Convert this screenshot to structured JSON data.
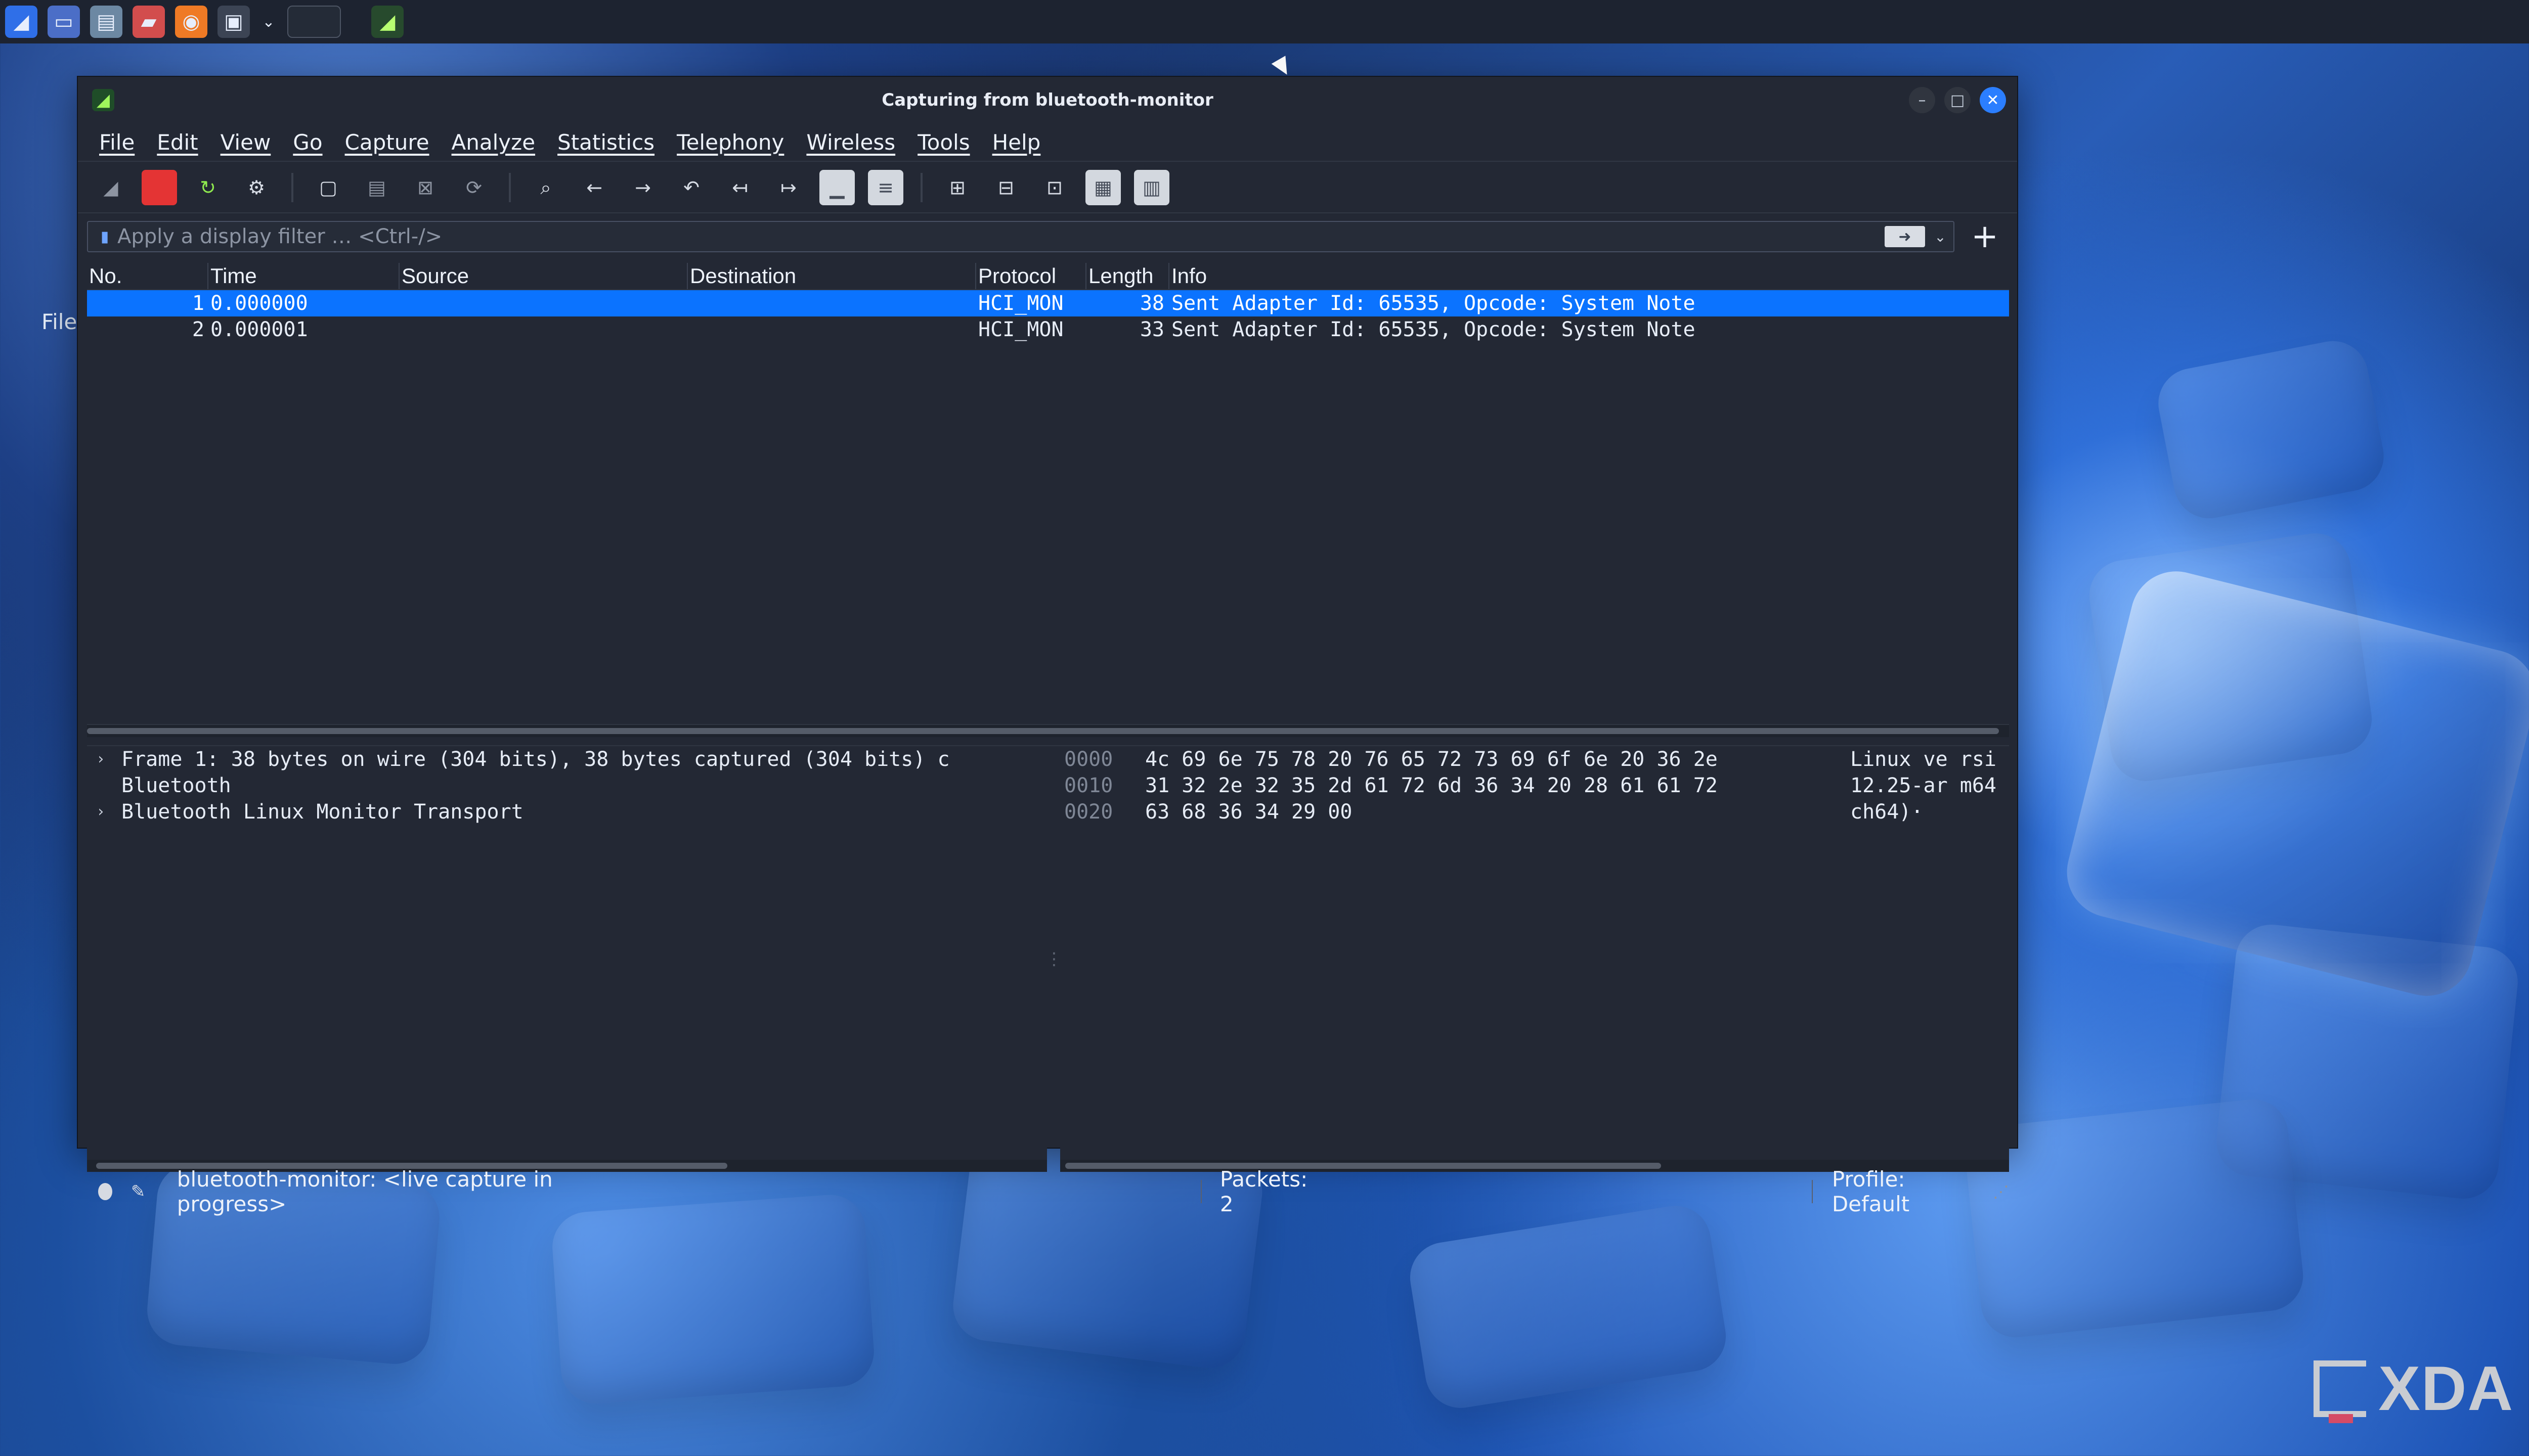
{
  "taskbar": {
    "icons": [
      "kali-menu-icon",
      "desktop-icon",
      "folder-icon",
      "text-editor-icon",
      "firefox-icon",
      "terminal-icon",
      "chevron-down-icon",
      "blank-window-icon",
      "wireshark-icon"
    ]
  },
  "desktop": {
    "file_label": "File"
  },
  "window": {
    "title": "Capturing from bluetooth-monitor",
    "menu": [
      "File",
      "Edit",
      "View",
      "Go",
      "Capture",
      "Analyze",
      "Statistics",
      "Telephony",
      "Wireless",
      "Tools",
      "Help"
    ],
    "filter": {
      "placeholder": "Apply a display filter … <Ctrl-/>",
      "value": ""
    },
    "packet_list": {
      "headers": [
        "No.",
        "Time",
        "Source",
        "Destination",
        "Protocol",
        "Length",
        "Info"
      ],
      "rows": [
        {
          "no": "1",
          "time": "0.000000",
          "source": "",
          "destination": "",
          "protocol": "HCI_MON",
          "length": "38",
          "info": "Sent Adapter Id: 65535, Opcode: System Note"
        },
        {
          "no": "2",
          "time": "0.000001",
          "source": "",
          "destination": "",
          "protocol": "HCI_MON",
          "length": "33",
          "info": "Sent Adapter Id: 65535, Opcode: System Note"
        }
      ]
    },
    "details": {
      "rows": [
        {
          "arrow": "›",
          "text": "Frame 1: 38 bytes on wire (304 bits), 38 bytes captured (304 bits) c"
        },
        {
          "arrow": "",
          "text": "Bluetooth"
        },
        {
          "arrow": "›",
          "text": "Bluetooth Linux Monitor Transport"
        }
      ]
    },
    "bytes": {
      "rows": [
        {
          "offset": "0000",
          "hex": "4c 69 6e 75 78 20 76 65  72 73 69 6f 6e 20 36 2e",
          "ascii": "Linux ve rsi"
        },
        {
          "offset": "0010",
          "hex": "31 32 2e 32 35 2d 61 72  6d 36 34 20 28 61 61 72",
          "ascii": "12.25-ar m64"
        },
        {
          "offset": "0020",
          "hex": "63 68 36 34 29 00",
          "ascii": "ch64)·"
        }
      ]
    },
    "status": {
      "capture": "bluetooth-monitor: <live capture in progress>",
      "packets": "Packets: 2",
      "profile": "Profile: Default"
    }
  },
  "watermark": {
    "text": "XDA"
  },
  "colors": {
    "selection": "#0b73ff",
    "window_bg": "#232834"
  }
}
